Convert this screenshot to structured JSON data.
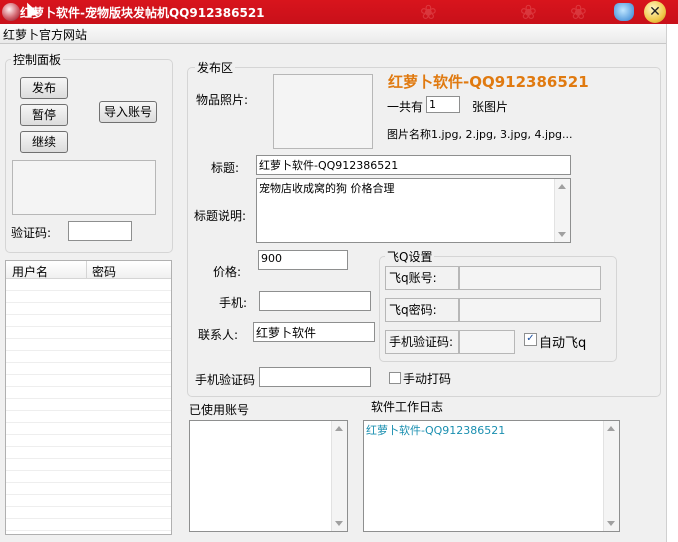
{
  "window": {
    "title": "红萝卜软件-宠物版块发帖机QQ912386521",
    "close_glyph": "✕"
  },
  "menu": {
    "site_link": "红萝卜官方网站"
  },
  "control_panel": {
    "title": "控制面板",
    "publish": "发布",
    "pause": "暂停",
    "resume": "继续",
    "import_accounts": "导入账号",
    "captcha_label": "验证码:",
    "captcha_value": ""
  },
  "accounts_table": {
    "columns": [
      "用户名",
      "密码"
    ],
    "rows": []
  },
  "publish_area": {
    "title": "发布区",
    "photo_label": "物品照片:",
    "brand_heading": "红萝卜软件-QQ912386521",
    "count_prefix": "一共有",
    "count_value": "1",
    "count_suffix": "张图片",
    "image_names": "图片名称1.jpg, 2.jpg, 3.jpg, 4.jpg...",
    "subject_label": "标题:",
    "subject_value": "红萝卜软件-QQ912386521",
    "description_label": "标题说明:",
    "description_value": "宠物店收成窝的狗 价格合理",
    "price_label": "价格:",
    "price_value": "900",
    "phone_label": "手机:",
    "phone_value": "",
    "contact_label": "联系人:",
    "contact_value": "红萝卜软件",
    "phone_code_label": "手机验证码",
    "phone_code_value": "",
    "manual_captcha_label": "手动打码",
    "manual_captcha_checked": false
  },
  "feiq": {
    "title": "飞Q设置",
    "account_label": "飞q账号:",
    "password_label": "飞q密码:",
    "phone_code_label": "手机验证码:",
    "auto_label": "自动飞q",
    "auto_checked": true
  },
  "used_accounts": {
    "title": "已使用账号"
  },
  "log": {
    "title": "软件工作日志",
    "lines": [
      "红萝卜软件-QQ912386521"
    ],
    "text_color": "#1a8fb0"
  },
  "colors": {
    "titlebar": "#c8101a",
    "brand_orange": "#e07a10"
  }
}
